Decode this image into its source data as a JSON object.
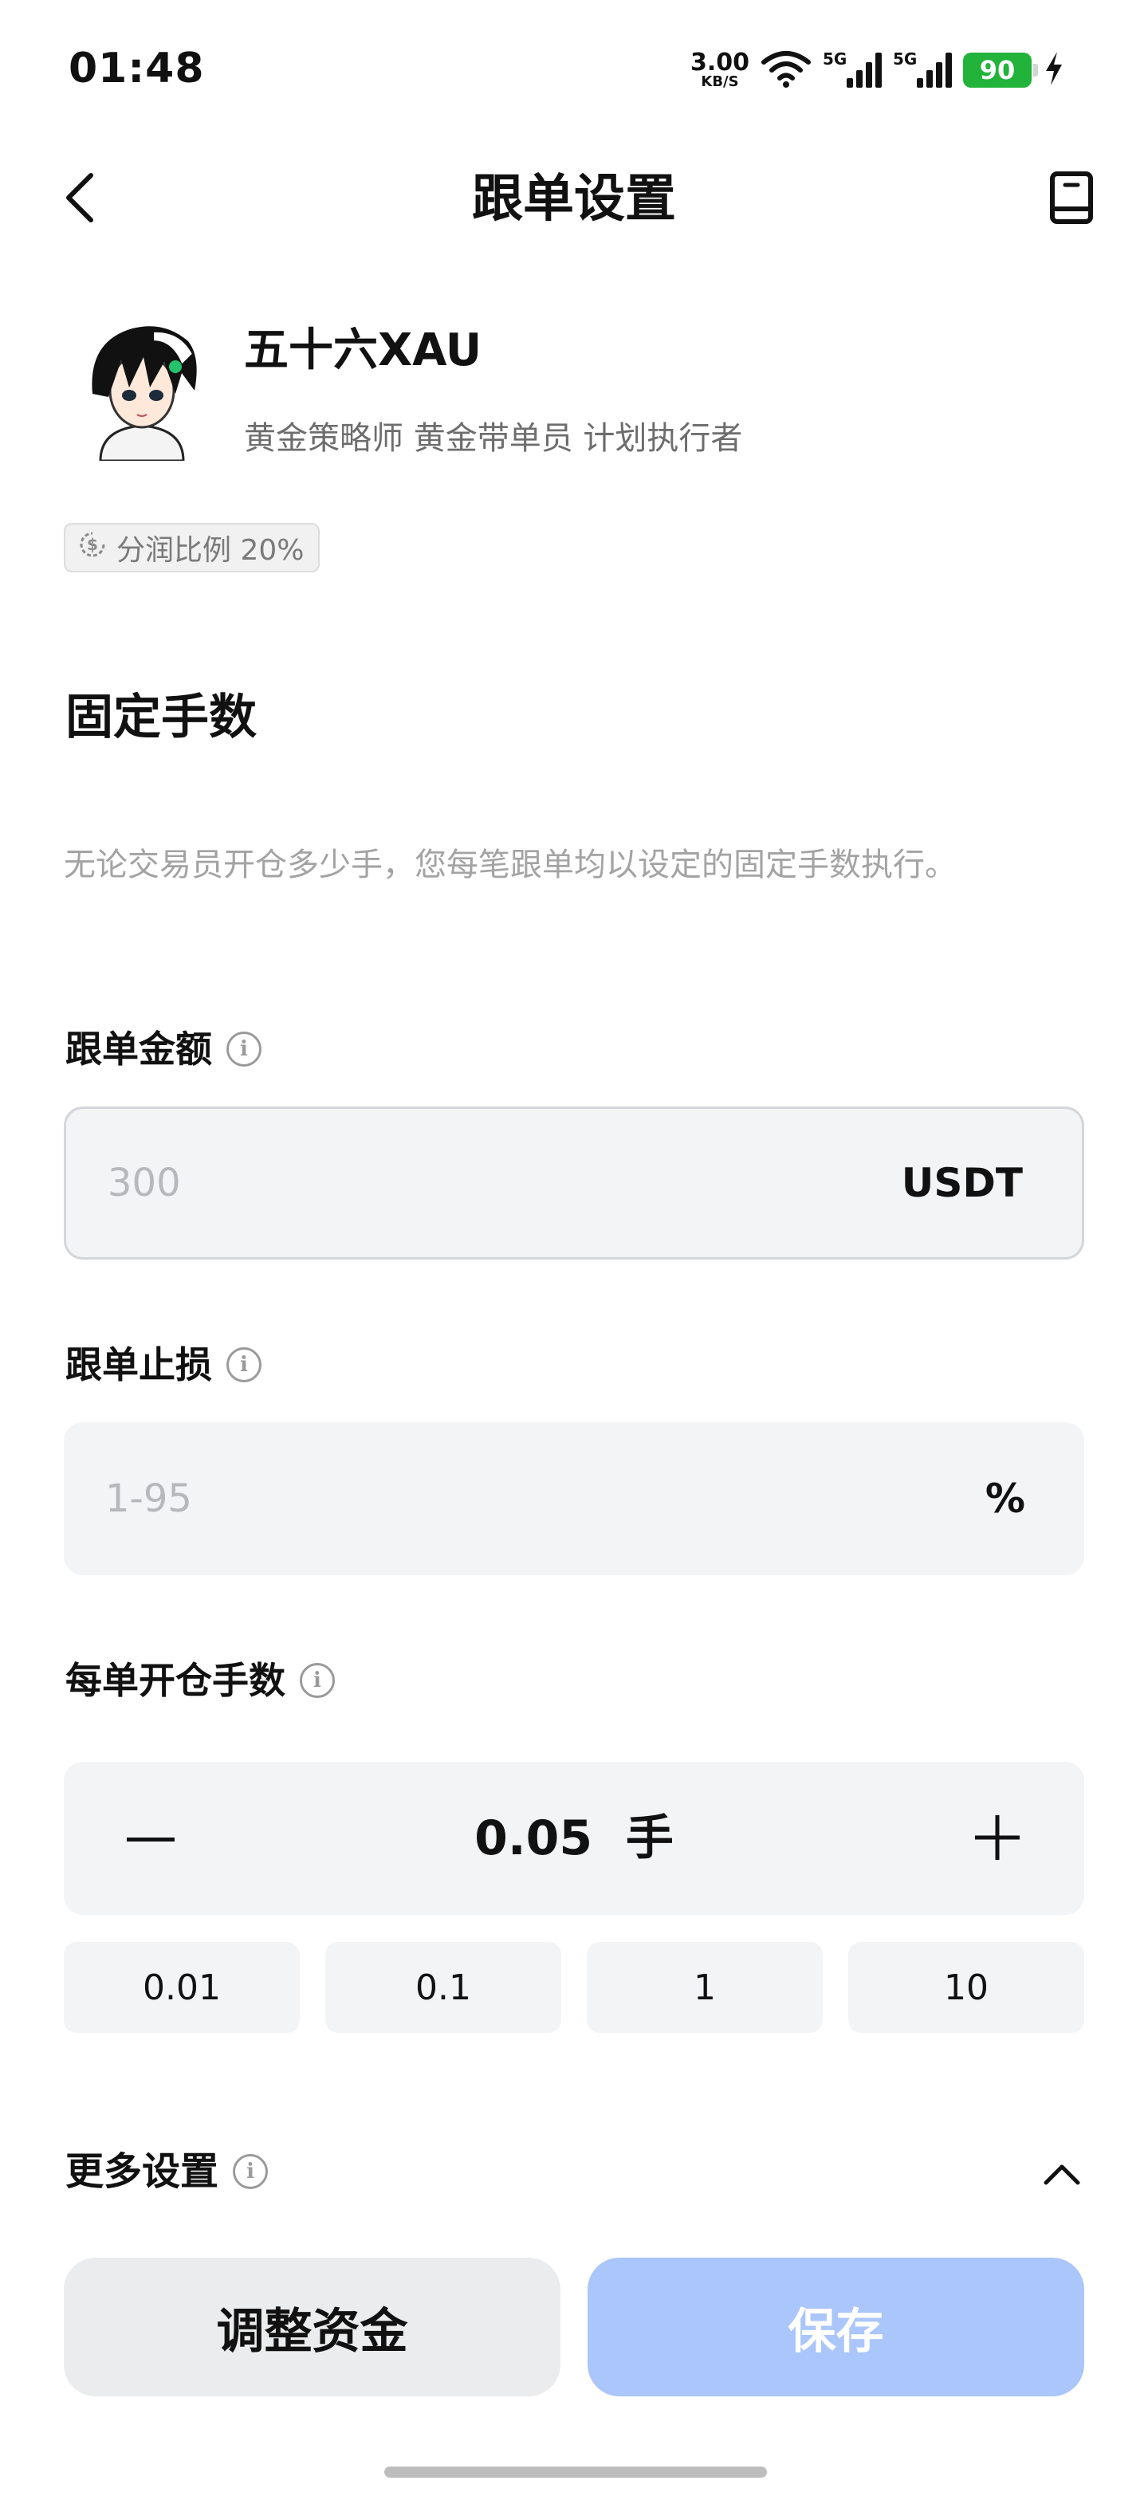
{
  "status_bar": {
    "time": "01:48",
    "net_speed_value": "3.00",
    "net_speed_unit": "KB/S",
    "signal1_tag": "5G",
    "signal2_tag": "5G",
    "battery": "90",
    "battery_color": "#22b33a"
  },
  "header": {
    "title": "跟单设置",
    "back_icon": "chevron-left-icon",
    "right_icon": "guide-book-icon"
  },
  "trader": {
    "name": "五十六XAU",
    "tags": "黄金策略师 黄金带单员 计划执行者",
    "profit_share": "分润比例 20%"
  },
  "mode": {
    "title": "固定手数",
    "description": "无论交易员开仓多少手，您每笔跟单均以设定的固定手数执行。"
  },
  "fields": {
    "amount": {
      "label": "跟单金额",
      "placeholder": "300",
      "unit": "USDT"
    },
    "stop_loss": {
      "label": "跟单止损",
      "placeholder": "1-95",
      "unit": "%"
    },
    "lots": {
      "label": "每单开仓手数",
      "value": "0.05  手",
      "quick": [
        "0.01",
        "0.1",
        "1",
        "10"
      ]
    }
  },
  "more_settings": {
    "label": "更多设置"
  },
  "buttons": {
    "adjust_funds": "调整资金",
    "save": "保存",
    "save_color": "#aac6fa"
  }
}
